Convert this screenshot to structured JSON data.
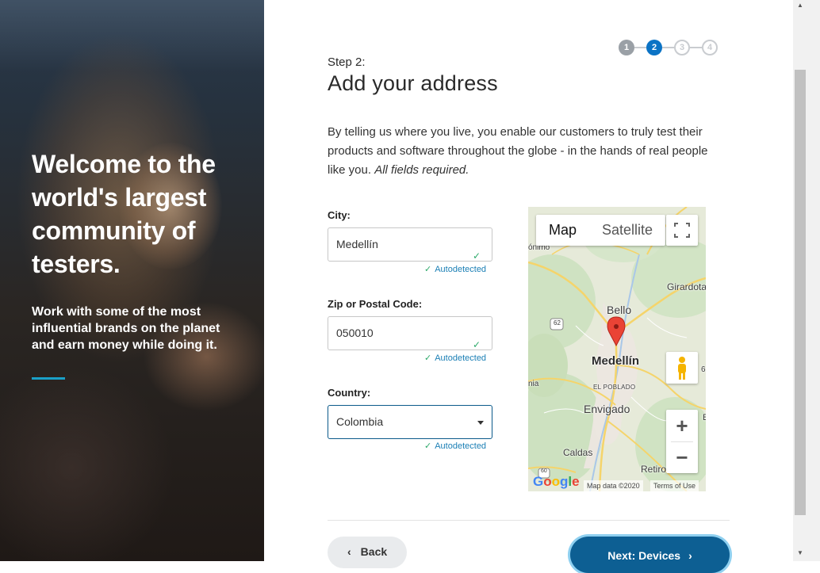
{
  "hero": {
    "title": "Welcome to the world's largest community of testers.",
    "subtitle": "Work with some of the most influential brands on the planet and earn money while doing it."
  },
  "stepper": {
    "steps": [
      "1",
      "2",
      "3",
      "4"
    ],
    "current": 2
  },
  "heading": {
    "step_label": "Step 2:",
    "title": "Add your address"
  },
  "intro": {
    "text": "By telling us where you live, you enable our customers to truly test their products and software throughout the globe - in the hands of real people like you.",
    "emphasis": "All fields required."
  },
  "form": {
    "city": {
      "label": "City:",
      "value": "Medellín",
      "status": "Autodetected"
    },
    "zip": {
      "label": "Zip or Postal Code:",
      "value": "050010",
      "status": "Autodetected"
    },
    "country": {
      "label": "Country:",
      "value": "Colombia",
      "status": "Autodetected"
    }
  },
  "map": {
    "type_map": "Map",
    "type_satellite": "Satellite",
    "labels": {
      "onimo": "ónimo",
      "girardota": "Girardota",
      "bello": "Bello",
      "medellin": "Medellín",
      "el_poblado": "EL POBLADO",
      "envigado": "Envigado",
      "caldas": "Caldas",
      "retiro": "Retiro",
      "nia": "nia",
      "r62": "62",
      "r60": "60",
      "e": "E",
      "six": "6"
    },
    "logo": "Google",
    "attribution": "Map data ©2020",
    "terms": "Terms of Use",
    "zoom_in": "+",
    "zoom_out": "−"
  },
  "nav": {
    "back": "Back",
    "next": "Next: Devices"
  },
  "colors": {
    "primary": "#0d5f93",
    "accent": "#0b73c5",
    "hero_accent": "#1aa0c8",
    "success": "#2eaa6b"
  }
}
